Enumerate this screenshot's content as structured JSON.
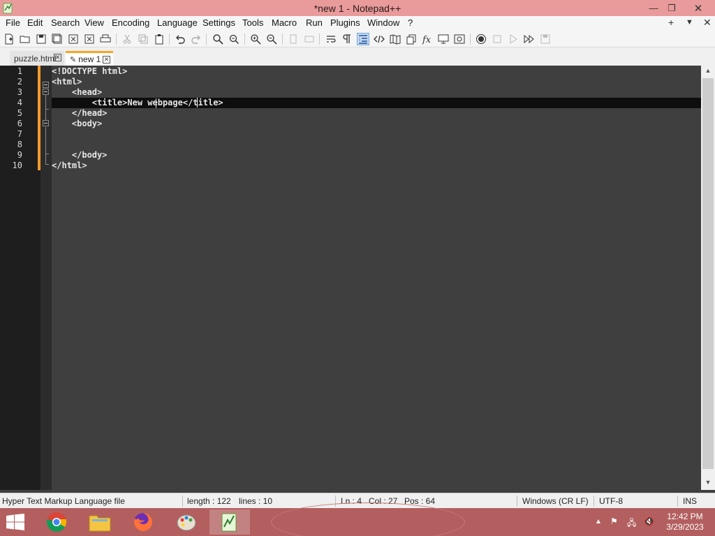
{
  "window": {
    "title": "*new 1 - Notepad++",
    "controls": {
      "minimize": "—",
      "maximize": "❐",
      "close": "✕"
    }
  },
  "menubar": {
    "items": [
      "File",
      "Edit",
      "Search",
      "View",
      "Encoding",
      "Language",
      "Settings",
      "Tools",
      "Macro",
      "Run",
      "Plugins",
      "Window",
      "?"
    ],
    "right_controls": {
      "add": "+",
      "dropdown": "▼",
      "close": "✕"
    }
  },
  "toolbar": {
    "buttons": [
      "new-file-icon",
      "open-file-icon",
      "save-icon",
      "save-all-icon",
      "close-icon",
      "close-all-icon",
      "print-icon",
      "cut-icon",
      "copy-icon",
      "paste-icon",
      "undo-icon",
      "redo-icon",
      "find-icon",
      "replace-icon",
      "zoom-in-icon",
      "zoom-out-icon",
      "sync-vertical-icon",
      "sync-horizontal-icon",
      "word-wrap-icon",
      "show-all-chars-icon",
      "indent-guide-icon",
      "xml-tag-icon",
      "document-map-icon",
      "document-list-icon",
      "function-list-icon",
      "folder-as-workspace-icon",
      "monitoring-icon",
      "record-macro-icon",
      "stop-record-icon",
      "play-macro-icon",
      "run-macro-multiple-icon",
      "save-macro-icon"
    ],
    "active": "indent-guide-icon"
  },
  "tabs": [
    {
      "label": "puzzle.html",
      "active": false,
      "close": "✕"
    },
    {
      "label": "new 1",
      "active": true,
      "close": "✕",
      "modified_icon": "✎"
    }
  ],
  "editor": {
    "lines": [
      "<!DOCTYPE html>",
      "<html>",
      "    <head>",
      "        <title>New webpage</title>",
      "    </head>",
      "    <body>",
      "",
      "",
      "    </body>",
      "</html>"
    ],
    "line_numbers": [
      "1",
      "2",
      "3",
      "4",
      "5",
      "6",
      "7",
      "8",
      "9",
      "10"
    ],
    "current_line": 4,
    "colors": {
      "background": "#3f3f3f",
      "text": "#e6e6e6",
      "change_marker": "#f19b2c",
      "current_line": "#0e0e0e"
    }
  },
  "statusbar": {
    "filetype": "Hyper Text Markup Language file",
    "length": "length : 122",
    "lines": "lines : 10",
    "ln": "Ln : 4",
    "col": "Col : 27",
    "pos": "Pos : 64",
    "eol": "Windows (CR LF)",
    "encoding": "UTF-8",
    "mode": "INS"
  },
  "taskbar": {
    "apps": [
      "chrome-icon",
      "file-explorer-icon",
      "firefox-icon",
      "paint-icon",
      "notepadpp-icon"
    ],
    "active_app": "notepadpp-icon",
    "tray": {
      "chevron": "▲",
      "flag": "⚑",
      "network": "🖧",
      "volume": "🔇"
    },
    "time": "12:42 PM",
    "date": "3/29/2023",
    "color": "#b35f5f"
  }
}
